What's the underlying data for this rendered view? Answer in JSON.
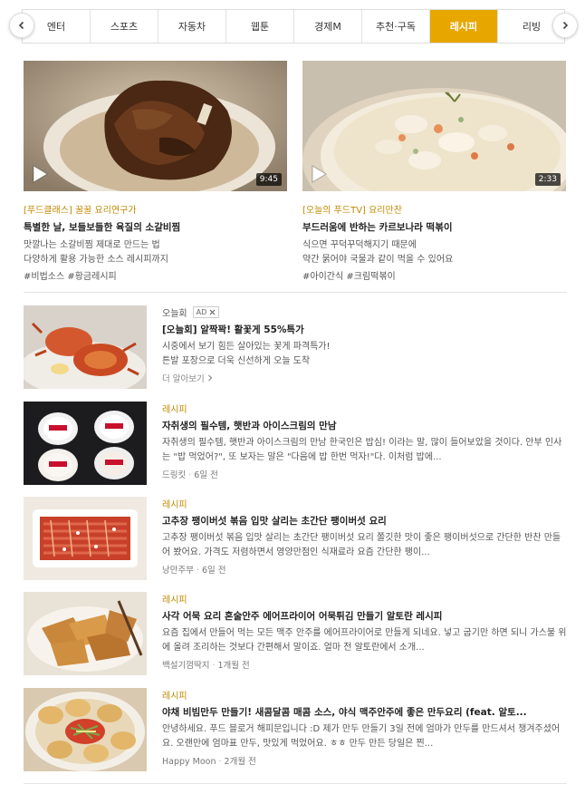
{
  "tabs": [
    {
      "label": "엔터",
      "active": false
    },
    {
      "label": "스포츠",
      "active": false
    },
    {
      "label": "자동차",
      "active": false
    },
    {
      "label": "웹툰",
      "active": false
    },
    {
      "label": "경제M",
      "active": false
    },
    {
      "label": "추천·구독",
      "active": false
    },
    {
      "label": "레시피",
      "active": true
    },
    {
      "label": "리빙",
      "active": false
    }
  ],
  "featured": [
    {
      "category": "[푸드클래스] 꿀꿀 요리연구가",
      "title": "특별한 날, 보들보들한 육질의 소갈비찜",
      "desc_line1": "맛깔나는 소갈비찜 제대로 만드는 법",
      "desc_line2": "다양하게 활용 가능한 소스 레시피까지",
      "tags": "#비법소스 #황금레시피",
      "duration": "9:45"
    },
    {
      "category": "[오늘의 푸드TV] 요리만찬",
      "title": "부드러움에 반하는 카르보나라 떡볶이",
      "desc_line1": "식으면 꾸덕꾸덕해지기 때문에",
      "desc_line2": "약간 묽어야 국물과 같이 먹을 수 있어요",
      "tags": "#아이간식 #크림떡볶이",
      "duration": "2:33"
    }
  ],
  "ad": {
    "advertiser": "오늘회",
    "badge": "AD",
    "title": "[오늘회] 알짝꽉! 활꽃게 55%특가",
    "line1": "시중에서 보기 힘든 살아있는 꽃게 파격특가!",
    "line2": "튼발 포장으로 더욱 신선하게 오늘 도착",
    "more": "더 알아보기"
  },
  "items": [
    {
      "category": "레시피",
      "title": "자취생의 필수템, 햇반과 아이스크림의 만남",
      "desc": "자취생의 필수템, 햇반과 아이스크림의 만남 한국인은 밥심! 이라는 말, 많이 들어보았을 것이다. 안부 인사는 \"밥 먹었어?\", 또 보자는 말은 \"다음에 밥 한번 먹자!\"다. 이처럼 밥에...",
      "source": "드링킷",
      "time": "6일 전"
    },
    {
      "category": "레시피",
      "title": "고추장 팽이버섯 볶음 입맛 살리는 초간단 팽이버섯 요리",
      "desc": "고추장 팽이버섯 볶음 입맛 살리는 초간단 팽이버섯 요리 쫄깃한 맛이 좋은 팽이버섯으로 간단한 반찬 만들어 봤어요. 가격도 저렴하면서 영양만점인 식재료라 요즘 간단한 팽이...",
      "source": "낭만주부",
      "time": "6일 전"
    },
    {
      "category": "레시피",
      "title": "사각 어묵 요리 혼술안주 에어프라이어 어묵튀김 만들기 알토란 레시피",
      "desc": "요즘 집에서 만들어 먹는 모든 맥주 안주를 에어프라이어로 만들게 되네요. 넣고 굽기만 하면 되니 가스불 위에 올려 조리하는 것보다 간편해서 말이죠. 얼마 전 알토란에서 소개...",
      "source": "백설기껌딱지",
      "time": "1개월 전"
    },
    {
      "category": "레시피",
      "title": "야채 비빔만두 만들기! 새콤달콤 매콤 소스, 야식 맥주안주에 좋은 만두요리 (feat. 알토...",
      "desc": "안녕하세요. 푸드 블로거 해피문입니다 :D 제가 만두 만들기 3일 전에 엄마가 만두를 만드셔서 챙겨주셨어요. 오랜만에 엄마표 만두, 맛있게 먹었어요. ㅎㅎ 만두 만든 당일은 찐...",
      "source": "Happy Moon",
      "time": "2개월 전"
    }
  ]
}
